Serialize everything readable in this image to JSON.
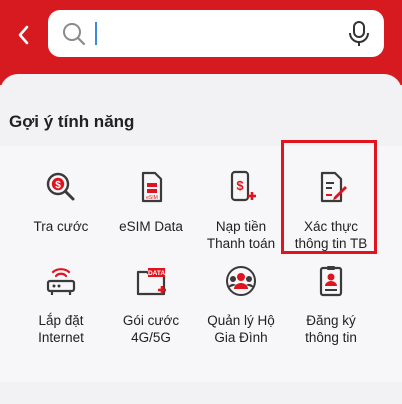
{
  "header": {
    "back_icon": "chevron-left-icon",
    "search": {
      "value": "",
      "placeholder": ""
    },
    "mic_icon": "microphone-icon",
    "colors": {
      "brand": "#d71920",
      "accent": "#d71920"
    }
  },
  "section": {
    "title": "Gợi ý tính năng"
  },
  "features": [
    {
      "label": "Tra cước",
      "icon": "search-money-icon"
    },
    {
      "label": "eSIM Data",
      "icon": "esim-card-icon"
    },
    {
      "label": "Nạp tiền\nThanh toán",
      "icon": "phone-topup-icon"
    },
    {
      "label": "Xác thực\nthông tin TB",
      "icon": "document-edit-icon",
      "highlighted": true
    },
    {
      "label": "Lắp đặt\nInternet",
      "icon": "router-icon"
    },
    {
      "label": "Gói cước\n4G/5G",
      "icon": "data-folder-icon"
    },
    {
      "label": "Quản lý Hộ\nGia Đình",
      "icon": "family-group-icon"
    },
    {
      "label": "Đăng ký\nthông tin",
      "icon": "user-form-icon"
    }
  ]
}
